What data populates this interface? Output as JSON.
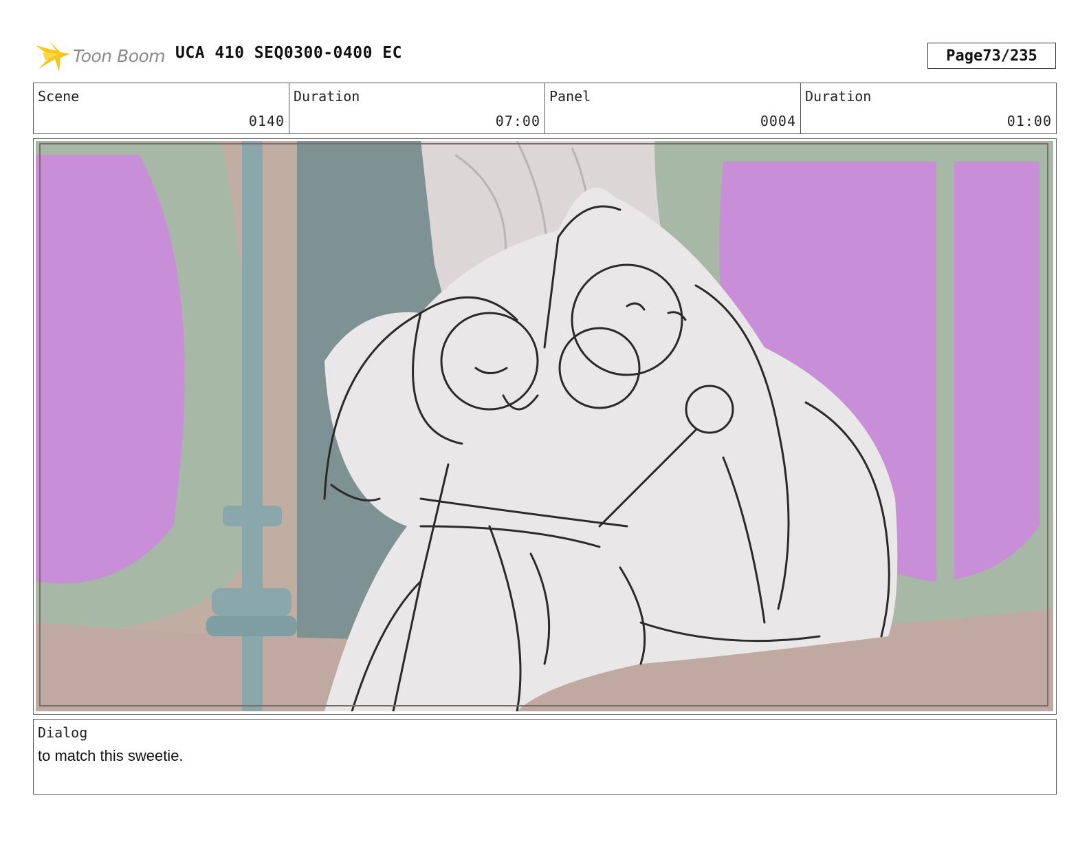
{
  "header": {
    "logo_text": "Toon Boom",
    "title": "UCA 410 SEQ0300-0400 EC",
    "page_label": "Page",
    "page_value": "73/235"
  },
  "info": {
    "scene_label": "Scene",
    "scene_value": "0140",
    "scene_duration_label": "Duration",
    "scene_duration_value": "07:00",
    "panel_label": "Panel",
    "panel_value": "0004",
    "panel_duration_label": "Duration",
    "panel_duration_value": "01:00"
  },
  "panel_image": {
    "icon": "storyboard-sketch-image"
  },
  "dialog": {
    "label": "Dialog",
    "text": "to match this sweetie."
  },
  "colors": {
    "logo_star": "#f5c518",
    "window_pink": "#c88fd8",
    "frame_green": "#a8b8a6",
    "wall_tan": "#c2ada2",
    "pillar_teal": "#8aa8ab"
  }
}
